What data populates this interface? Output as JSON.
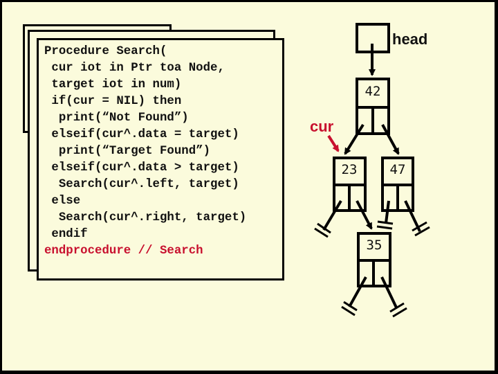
{
  "slide": {
    "background": "#FBFBDC",
    "accent_color": "#C8102E"
  },
  "code_panel": {
    "lines": [
      "Procedure Search(",
      " cur iot in Ptr toa Node,",
      " target iot in num)",
      " if(cur = NIL) then",
      "  print(“Not Found”)",
      " elseif(cur^.data = target)",
      "  print(“Target Found”)",
      " elseif(cur^.data > target)",
      "  Search(cur^.left, target)",
      " else",
      "  Search(cur^.right, target)",
      " endif"
    ],
    "end_line": "endprocedure // Search"
  },
  "tree": {
    "head_label": "head",
    "cur_label": "cur",
    "nodes": [
      {
        "id": "root",
        "value": "42"
      },
      {
        "id": "left",
        "value": "23"
      },
      {
        "id": "right",
        "value": "47"
      },
      {
        "id": "left-right",
        "value": "35"
      }
    ]
  }
}
